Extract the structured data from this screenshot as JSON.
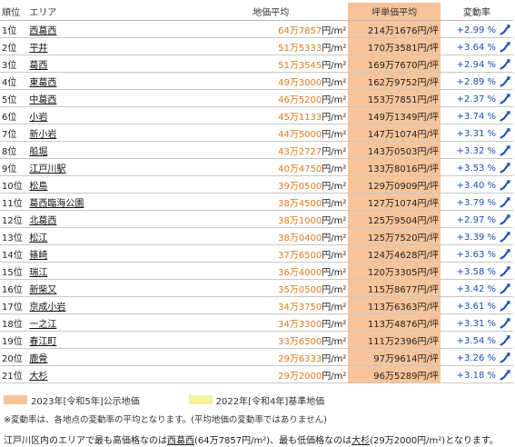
{
  "header": {
    "rank": "順位",
    "area": "エリア",
    "land_price": "地価平均",
    "tsubo_price": "坪単価平均",
    "change_rate": "変動率"
  },
  "rows": [
    {
      "rank": "1位",
      "area": "西葛西",
      "land": "64万7857",
      "tsubo": "214万1676円/坪",
      "rate": "+2.99 %"
    },
    {
      "rank": "2位",
      "area": "平井",
      "land": "51万5333",
      "tsubo": "170万3581円/坪",
      "rate": "+3.64 %"
    },
    {
      "rank": "3位",
      "area": "葛西",
      "land": "51万3545",
      "tsubo": "169万7670円/坪",
      "rate": "+2.94 %"
    },
    {
      "rank": "4位",
      "area": "東葛西",
      "land": "49万3000",
      "tsubo": "162万9752円/坪",
      "rate": "+2.89 %"
    },
    {
      "rank": "5位",
      "area": "中葛西",
      "land": "46万5200",
      "tsubo": "153万7851円/坪",
      "rate": "+2.37 %"
    },
    {
      "rank": "6位",
      "area": "小岩",
      "land": "45万1133",
      "tsubo": "149万1349円/坪",
      "rate": "+3.74 %"
    },
    {
      "rank": "7位",
      "area": "新小岩",
      "land": "44万5000",
      "tsubo": "147万1074円/坪",
      "rate": "+3.31 %"
    },
    {
      "rank": "8位",
      "area": "船堀",
      "land": "43万2727",
      "tsubo": "143万0503円/坪",
      "rate": "+3.32 %"
    },
    {
      "rank": "9位",
      "area": "江戸川駅",
      "land": "40万4750",
      "tsubo": "133万8016円/坪",
      "rate": "+3.53 %"
    },
    {
      "rank": "10位",
      "area": "松島",
      "land": "39万0500",
      "tsubo": "129万0909円/坪",
      "rate": "+3.40 %"
    },
    {
      "rank": "11位",
      "area": "葛西臨海公園",
      "land": "38万4500",
      "tsubo": "127万1074円/坪",
      "rate": "+3.79 %"
    },
    {
      "rank": "12位",
      "area": "北葛西",
      "land": "38万1000",
      "tsubo": "125万9504円/坪",
      "rate": "+2.97 %"
    },
    {
      "rank": "13位",
      "area": "松江",
      "land": "38万0400",
      "tsubo": "125万7520円/坪",
      "rate": "+3.39 %"
    },
    {
      "rank": "14位",
      "area": "篠崎",
      "land": "37万6500",
      "tsubo": "124万4628円/坪",
      "rate": "+3.63 %"
    },
    {
      "rank": "15位",
      "area": "瑞江",
      "land": "36万4000",
      "tsubo": "120万3305円/坪",
      "rate": "+3.58 %"
    },
    {
      "rank": "16位",
      "area": "新柴又",
      "land": "35万0500",
      "tsubo": "115万8677円/坪",
      "rate": "+3.42 %"
    },
    {
      "rank": "17位",
      "area": "京成小岩",
      "land": "34万3750",
      "tsubo": "113万6363円/坪",
      "rate": "+3.61 %"
    },
    {
      "rank": "18位",
      "area": "一之江",
      "land": "34万3300",
      "tsubo": "113万4876円/坪",
      "rate": "+3.31 %"
    },
    {
      "rank": "19位",
      "area": "春江町",
      "land": "33万6500",
      "tsubo": "111万2396円/坪",
      "rate": "+3.54 %"
    },
    {
      "rank": "20位",
      "area": "鹿骨",
      "land": "29万6333",
      "tsubo": "97万9614円/坪",
      "rate": "+3.26 %"
    },
    {
      "rank": "21位",
      "area": "大杉",
      "land": "29万2000",
      "tsubo": "96万5289円/坪",
      "rate": "+3.18 %"
    }
  ],
  "land_unit": "円/m²",
  "trend_icon": "trend-up-arrow-icon",
  "legend": {
    "orange_label": "2023年[令和5年]公示地価",
    "yellow_label": "2022年[令和4年]基準地価",
    "orange_color": "#f7c49a",
    "yellow_color": "#f4f29a"
  },
  "note": "※変動率は、各地点の変動率の平均となります。(平均地価の変動率ではありません)",
  "summary": {
    "p1": "江戸川区内のエリアで最も高価格なのは",
    "high_area": "西葛西",
    "p2": "(64万7857円/m²)、最も低価格なのは",
    "low_area": "大杉",
    "p3": "(29万2000円/m²)となります。"
  }
}
